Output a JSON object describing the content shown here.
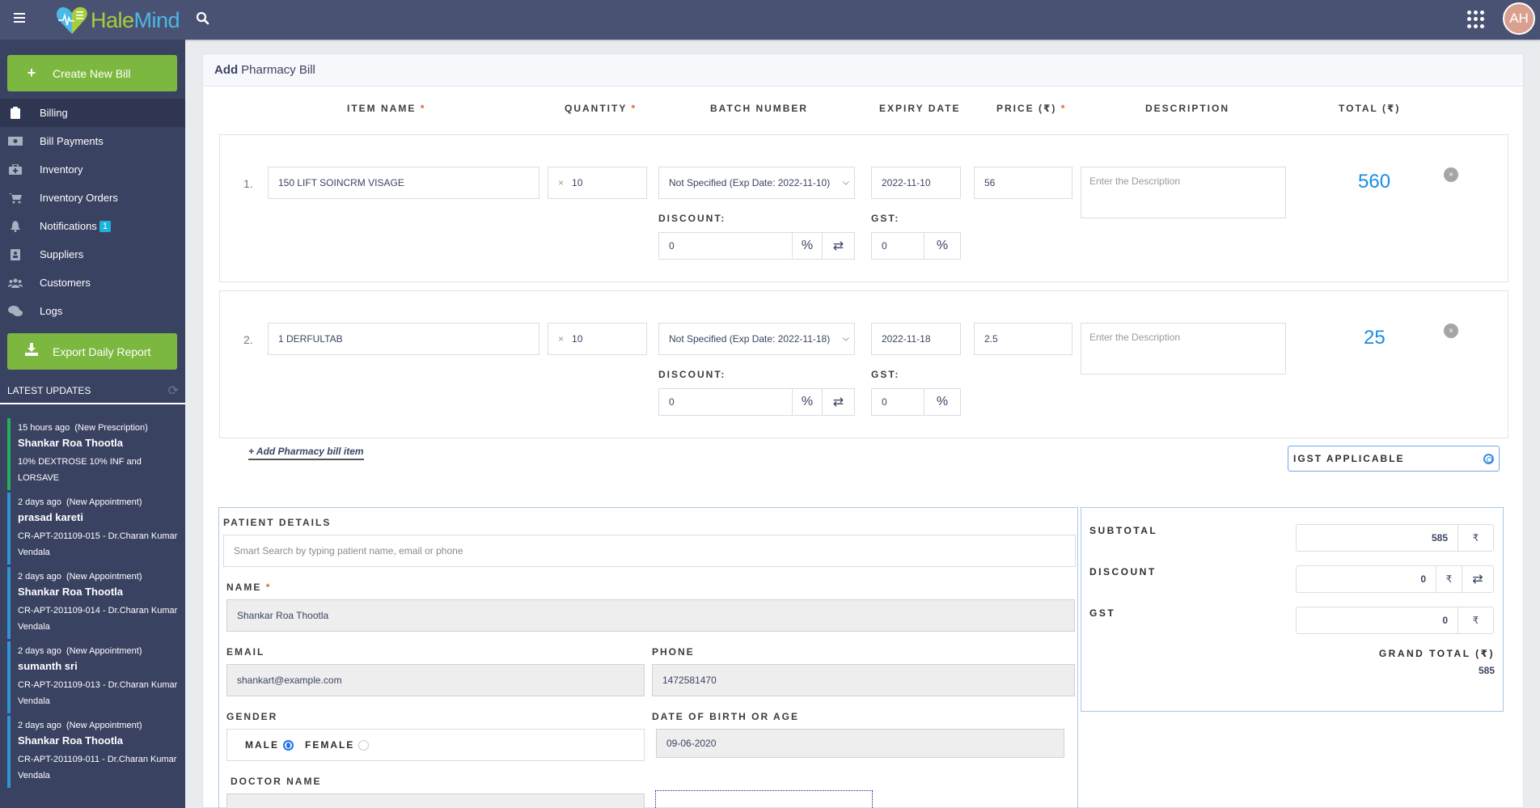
{
  "app": {
    "logo_part1": "Hale",
    "logo_part2": "Mind",
    "avatar_initials": "AH"
  },
  "icons": {
    "menu": "hamburger-icon",
    "search": "search-icon",
    "apps": "grid-icon",
    "refresh": "refresh-icon"
  },
  "sidebar": {
    "create_bill_label": "Create New Bill",
    "export_label": "Export Daily Report",
    "items": [
      {
        "label": "Billing",
        "icon": "clipboard-icon",
        "active": true
      },
      {
        "label": "Bill Payments",
        "icon": "money-icon"
      },
      {
        "label": "Inventory",
        "icon": "medkit-icon"
      },
      {
        "label": "Inventory Orders",
        "icon": "cart-icon"
      },
      {
        "label": "Notifications",
        "icon": "bell-icon",
        "badge": "1"
      },
      {
        "label": "Suppliers",
        "icon": "address-book-icon"
      },
      {
        "label": "Customers",
        "icon": "users-icon"
      },
      {
        "label": "Logs",
        "icon": "comments-icon"
      }
    ],
    "updates_title": "LATEST UPDATES",
    "updates": [
      {
        "time": "15 hours ago",
        "type": "(New Prescription)",
        "name": "Shankar Roa Thootla",
        "detail": "10% DEXTROSE 10% INF and LORSAVE",
        "color": "#22b05d"
      },
      {
        "time": "2 days ago",
        "type": "(New Appointment)",
        "name": "prasad kareti",
        "detail": "CR-APT-201109-015 - Dr.Charan Kumar Vendala",
        "color": "#2f95d6"
      },
      {
        "time": "2 days ago",
        "type": "(New Appointment)",
        "name": "Shankar Roa Thootla",
        "detail": "CR-APT-201109-014 - Dr.Charan Kumar Vendala",
        "color": "#2f95d6"
      },
      {
        "time": "2 days ago",
        "type": "(New Appointment)",
        "name": "sumanth sri",
        "detail": "CR-APT-201109-013 - Dr.Charan Kumar Vendala",
        "color": "#2f95d6"
      },
      {
        "time": "2 days ago",
        "type": "(New Appointment)",
        "name": "Shankar Roa Thootla",
        "detail": "CR-APT-201109-011 - Dr.Charan Kumar Vendala",
        "color": "#2f95d6"
      }
    ]
  },
  "bill": {
    "title_bold": "Add",
    "title_rest": "Pharmacy Bill",
    "columns": {
      "item_name": "ITEM NAME",
      "quantity": "QUANTITY",
      "batch_number": "BATCH NUMBER",
      "expiry_date": "EXPIRY DATE",
      "price": "PRICE (₹)",
      "description": "DESCRIPTION",
      "total": "TOTAL (₹)"
    },
    "required_mark": "*",
    "discount_label": "DISCOUNT:",
    "gst_label": "GST:",
    "description_placeholder": "Enter the Description",
    "items": [
      {
        "num": "1.",
        "name": "150 LIFT SOINCRM VISAGE",
        "qty_prefix": "×",
        "qty": "10",
        "batch": "Not Specified (Exp Date: 2022-11-10)",
        "expiry": "2022-11-10",
        "price": "56",
        "discount": "0",
        "discount_unit": "%",
        "gst": "0",
        "gst_unit": "%",
        "total": "560"
      },
      {
        "num": "2.",
        "name": "1 DERFULTAB",
        "qty_prefix": "×",
        "qty": "10",
        "batch": "Not Specified (Exp Date: 2022-11-18)",
        "expiry": "2022-11-18",
        "price": "2.5",
        "discount": "0",
        "discount_unit": "%",
        "gst": "0",
        "gst_unit": "%",
        "total": "25"
      }
    ],
    "add_item_label": "+ Add Pharmacy bill item",
    "igst_label": "IGST APPLICABLE"
  },
  "patient": {
    "section_title": "PATIENT DETAILS",
    "search_placeholder": "Smart Search by typing patient name, email or phone",
    "name_label": "NAME",
    "name_value": "Shankar Roa Thootla",
    "email_label": "EMAIL",
    "email_value": "shankart@example.com",
    "phone_label": "PHONE",
    "phone_value": "1472581470",
    "gender_label": "GENDER",
    "gender_male": "MALE",
    "gender_female": "FEMALE",
    "gender_selected": "MALE",
    "dob_label": "DATE OF BIRTH OR AGE",
    "dob_value": "09-06-2020",
    "doctor_label": "DOCTOR NAME"
  },
  "summary": {
    "subtotal_label": "SUBTOTAL",
    "subtotal_value": "585",
    "discount_label": "DISCOUNT",
    "discount_value": "0",
    "gst_label": "GST",
    "gst_value": "0",
    "currency": "₹",
    "grand_total_label": "GRAND TOTAL (₹)",
    "grand_total_value": "585"
  }
}
